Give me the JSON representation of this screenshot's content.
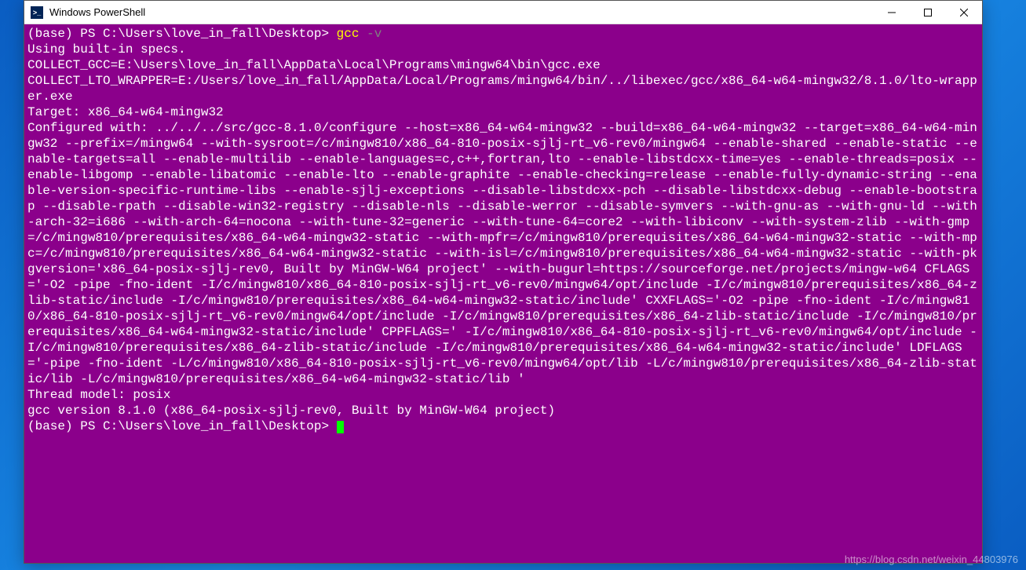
{
  "window": {
    "title": "Windows PowerShell"
  },
  "terminal": {
    "prompt1_env": "(base) ",
    "prompt1_path": "PS C:\\Users\\love_in_fall\\Desktop> ",
    "command": "gcc",
    "option": " -v",
    "line_specs": "Using built-in specs.",
    "line_collect_gcc": "COLLECT_GCC=E:\\Users\\love_in_fall\\AppData\\Local\\Programs\\mingw64\\bin\\gcc.exe",
    "line_collect_lto": "COLLECT_LTO_WRAPPER=E:/Users/love_in_fall/AppData/Local/Programs/mingw64/bin/../libexec/gcc/x86_64-w64-mingw32/8.1.0/lto-wrapper.exe",
    "line_target": "Target: x86_64-w64-mingw32",
    "line_configured": "Configured with: ../../../src/gcc-8.1.0/configure --host=x86_64-w64-mingw32 --build=x86_64-w64-mingw32 --target=x86_64-w64-mingw32 --prefix=/mingw64 --with-sysroot=/c/mingw810/x86_64-810-posix-sjlj-rt_v6-rev0/mingw64 --enable-shared --enable-static --enable-targets=all --enable-multilib --enable-languages=c,c++,fortran,lto --enable-libstdcxx-time=yes --enable-threads=posix --enable-libgomp --enable-libatomic --enable-lto --enable-graphite --enable-checking=release --enable-fully-dynamic-string --enable-version-specific-runtime-libs --enable-sjlj-exceptions --disable-libstdcxx-pch --disable-libstdcxx-debug --enable-bootstrap --disable-rpath --disable-win32-registry --disable-nls --disable-werror --disable-symvers --with-gnu-as --with-gnu-ld --with-arch-32=i686 --with-arch-64=nocona --with-tune-32=generic --with-tune-64=core2 --with-libiconv --with-system-zlib --with-gmp=/c/mingw810/prerequisites/x86_64-w64-mingw32-static --with-mpfr=/c/mingw810/prerequisites/x86_64-w64-mingw32-static --with-mpc=/c/mingw810/prerequisites/x86_64-w64-mingw32-static --with-isl=/c/mingw810/prerequisites/x86_64-w64-mingw32-static --with-pkgversion='x86_64-posix-sjlj-rev0, Built by MinGW-W64 project' --with-bugurl=https://sourceforge.net/projects/mingw-w64 CFLAGS='-O2 -pipe -fno-ident -I/c/mingw810/x86_64-810-posix-sjlj-rt_v6-rev0/mingw64/opt/include -I/c/mingw810/prerequisites/x86_64-zlib-static/include -I/c/mingw810/prerequisites/x86_64-w64-mingw32-static/include' CXXFLAGS='-O2 -pipe -fno-ident -I/c/mingw810/x86_64-810-posix-sjlj-rt_v6-rev0/mingw64/opt/include -I/c/mingw810/prerequisites/x86_64-zlib-static/include -I/c/mingw810/prerequisites/x86_64-w64-mingw32-static/include' CPPFLAGS=' -I/c/mingw810/x86_64-810-posix-sjlj-rt_v6-rev0/mingw64/opt/include -I/c/mingw810/prerequisites/x86_64-zlib-static/include -I/c/mingw810/prerequisites/x86_64-w64-mingw32-static/include' LDFLAGS='-pipe -fno-ident -L/c/mingw810/x86_64-810-posix-sjlj-rt_v6-rev0/mingw64/opt/lib -L/c/mingw810/prerequisites/x86_64-zlib-static/lib -L/c/mingw810/prerequisites/x86_64-w64-mingw32-static/lib '",
    "line_thread": "Thread model: posix",
    "line_version": "gcc version 8.1.0 (x86_64-posix-sjlj-rev0, Built by MinGW-W64 project)",
    "prompt2_env": "(base) ",
    "prompt2_path": "PS C:\\Users\\love_in_fall\\Desktop> "
  },
  "watermark": "https://blog.csdn.net/weixin_44803976"
}
